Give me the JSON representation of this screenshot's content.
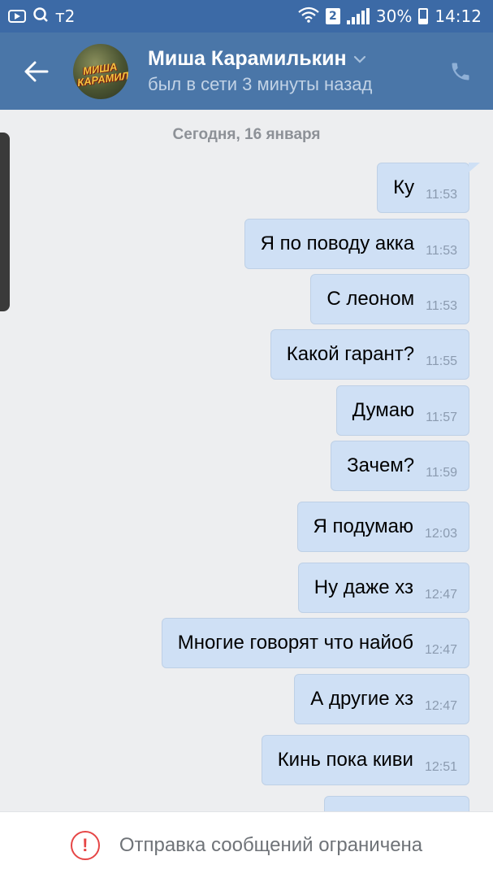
{
  "statusbar": {
    "carrier": "т2",
    "sim_slot": "2",
    "battery": "30%",
    "time": "14:12",
    "icons": [
      "video-icon",
      "search-icon",
      "wifi-icon",
      "signal-icon",
      "battery-icon"
    ]
  },
  "header": {
    "name": "Миша Карамилькин",
    "status": "был в сети 3 минуты назад",
    "avatar_text": "МИША КАРАМИЛЬКИН",
    "accent_color": "#4a76a8"
  },
  "chat": {
    "date_separator": "Сегодня, 16 января",
    "messages": [
      {
        "text": "Ку",
        "time": "11:53"
      },
      {
        "text": "Я по поводу акка",
        "time": "11:53"
      },
      {
        "text": "С леоном",
        "time": "11:53"
      },
      {
        "text": "Какой гарант?",
        "time": "11:55"
      },
      {
        "text": "Думаю",
        "time": "11:57"
      },
      {
        "text": "Зачем?",
        "time": "11:59"
      },
      {
        "text": "Я подумаю",
        "time": "12:03"
      },
      {
        "text": "Ну даже хз",
        "time": "12:47"
      },
      {
        "text": "Многие говорят что найоб",
        "time": "12:47"
      },
      {
        "text": "А другие хз",
        "time": "12:47"
      },
      {
        "text": "Кинь пока киви",
        "time": "12:51"
      }
    ],
    "bubble_color": "#cfe0f5"
  },
  "footer": {
    "text": "Отправка сообщений ограничена",
    "warning_color": "#e64646"
  }
}
